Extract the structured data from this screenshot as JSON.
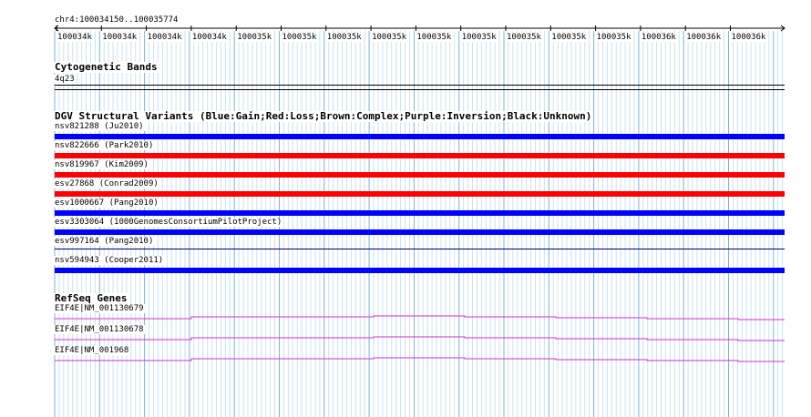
{
  "location": "chr4:100034150..100035774",
  "scale_ticks": [
    "100034k",
    "100034k",
    "100034k",
    "100034k",
    "100035k",
    "100035k",
    "100035k",
    "100035k",
    "100035k",
    "100035k",
    "100035k",
    "100035k",
    "100035k",
    "100036k",
    "100036k",
    "100036k"
  ],
  "cytoband": {
    "title": "Cytogenetic Bands",
    "band": "4q23"
  },
  "dgv": {
    "title": "DGV Structural Variants (Blue:Gain;Red:Loss;Brown:Complex;Purple:Inversion;Black:Unknown)",
    "variants": [
      {
        "label": "nsv821288 (Ju2010)",
        "color": "#0000ff",
        "type": "gain"
      },
      {
        "label": "nsv822666 (Park2010)",
        "color": "#ff0000",
        "type": "loss"
      },
      {
        "label": "nsv819967 (Kim2009)",
        "color": "#ff0000",
        "type": "loss"
      },
      {
        "label": "esv27868 (Conrad2009)",
        "color": "#ff0000",
        "type": "loss"
      },
      {
        "label": "esv1000667 (Pang2010)",
        "color": "#0000ff",
        "type": "gain"
      },
      {
        "label": "esv3303064 (1000GenomesConsortiumPilotProject)",
        "color": "#0000ff",
        "type": "gain"
      },
      {
        "label": "esv997164 (Pang2010)",
        "color": "#000066",
        "type": "unknown"
      },
      {
        "label": "nsv594943 (Cooper2011)",
        "color": "#0000ff",
        "type": "gain"
      }
    ]
  },
  "refseq": {
    "title": "RefSeq Genes",
    "genes": [
      {
        "label": "EIF4E|NM_001130679",
        "color": "#cc33cc"
      },
      {
        "label": "EIF4E|NM_001130678",
        "color": "#cc33cc"
      },
      {
        "label": "EIF4E|NM_001968",
        "color": "#cc33cc"
      }
    ]
  },
  "colors": {
    "grid_major": "#7fb2d9",
    "grid_minor": "#c9e3f2",
    "gene": "#cc33cc"
  }
}
